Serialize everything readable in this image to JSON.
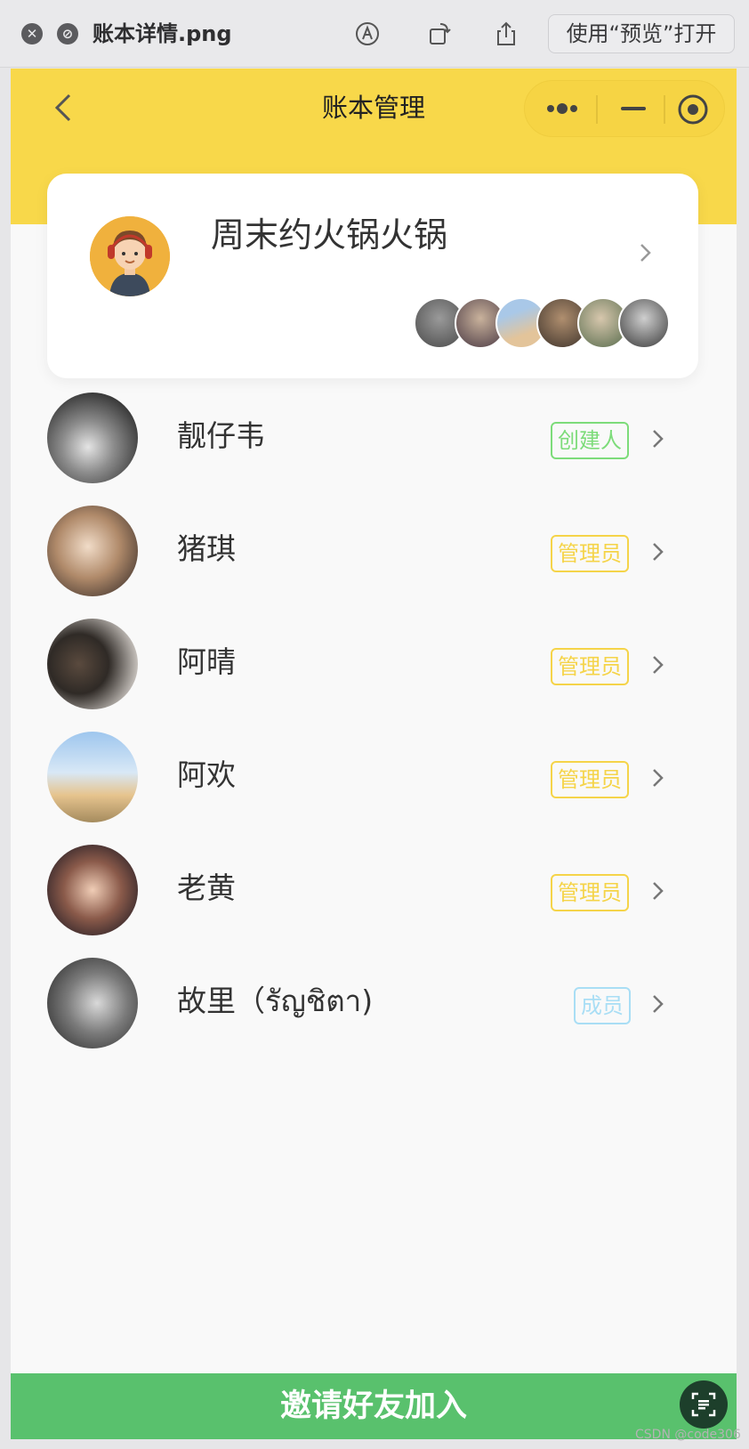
{
  "window": {
    "filename": "账本详情.png",
    "open_button_label": "使用“预览”打开"
  },
  "nav": {
    "title": "账本管理"
  },
  "book": {
    "name": "周末约火锅火锅",
    "avatar_icon": "cartoon-avatar-icon",
    "member_avatar_count": 6
  },
  "members": [
    {
      "name": "靓仔韦",
      "role": "创建人",
      "role_color": "#7ddc7a"
    },
    {
      "name": "猪琪",
      "role": "管理员",
      "role_color": "#f5d449"
    },
    {
      "name": "阿晴",
      "role": "管理员",
      "role_color": "#f5d449"
    },
    {
      "name": "阿欢",
      "role": "管理员",
      "role_color": "#f5d449"
    },
    {
      "name": "老黄",
      "role": "管理员",
      "role_color": "#f5d449"
    },
    {
      "name": "故里（รัญชิตา)",
      "role": "成员",
      "role_color": "#a9def5"
    }
  ],
  "footer": {
    "invite_label": "邀请好友加入"
  },
  "watermark": "CSDN @code306",
  "colors": {
    "header_yellow": "#f8d84a",
    "invite_green": "#59c16d"
  }
}
